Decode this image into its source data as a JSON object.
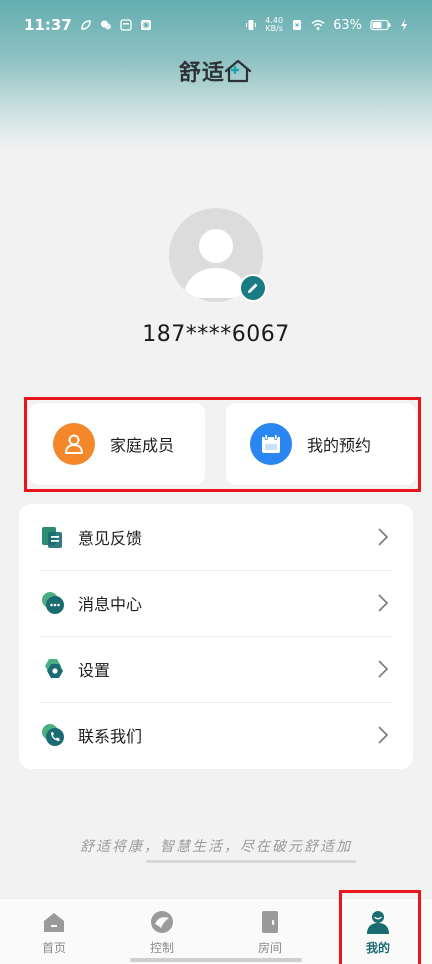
{
  "status_bar": {
    "time": "11:37",
    "speed_value": "4.40",
    "speed_unit": "KB/s",
    "battery": "63%"
  },
  "header": {
    "logo_text": "舒适"
  },
  "profile": {
    "phone": "187****6067"
  },
  "quick_actions": [
    {
      "label": "家庭成员",
      "icon": "family-members-icon",
      "color": "#f5872b"
    },
    {
      "label": "我的预约",
      "icon": "calendar-icon",
      "color": "#2a86f0"
    }
  ],
  "menu": [
    {
      "label": "意见反馈",
      "icon": "feedback-icon"
    },
    {
      "label": "消息中心",
      "icon": "message-icon"
    },
    {
      "label": "设置",
      "icon": "settings-icon"
    },
    {
      "label": "联系我们",
      "icon": "phone-icon"
    }
  ],
  "slogan": "舒适将康，智慧生活，尽在破元舒适加",
  "tabs": [
    {
      "label": "首页",
      "icon": "home-icon",
      "active": false
    },
    {
      "label": "控制",
      "icon": "control-icon",
      "active": false
    },
    {
      "label": "房间",
      "icon": "room-door-icon",
      "active": false
    },
    {
      "label": "我的",
      "icon": "profile-icon",
      "active": true
    }
  ],
  "colors": {
    "accent": "#1a7c83",
    "highlight_frame": "#e8151b"
  }
}
